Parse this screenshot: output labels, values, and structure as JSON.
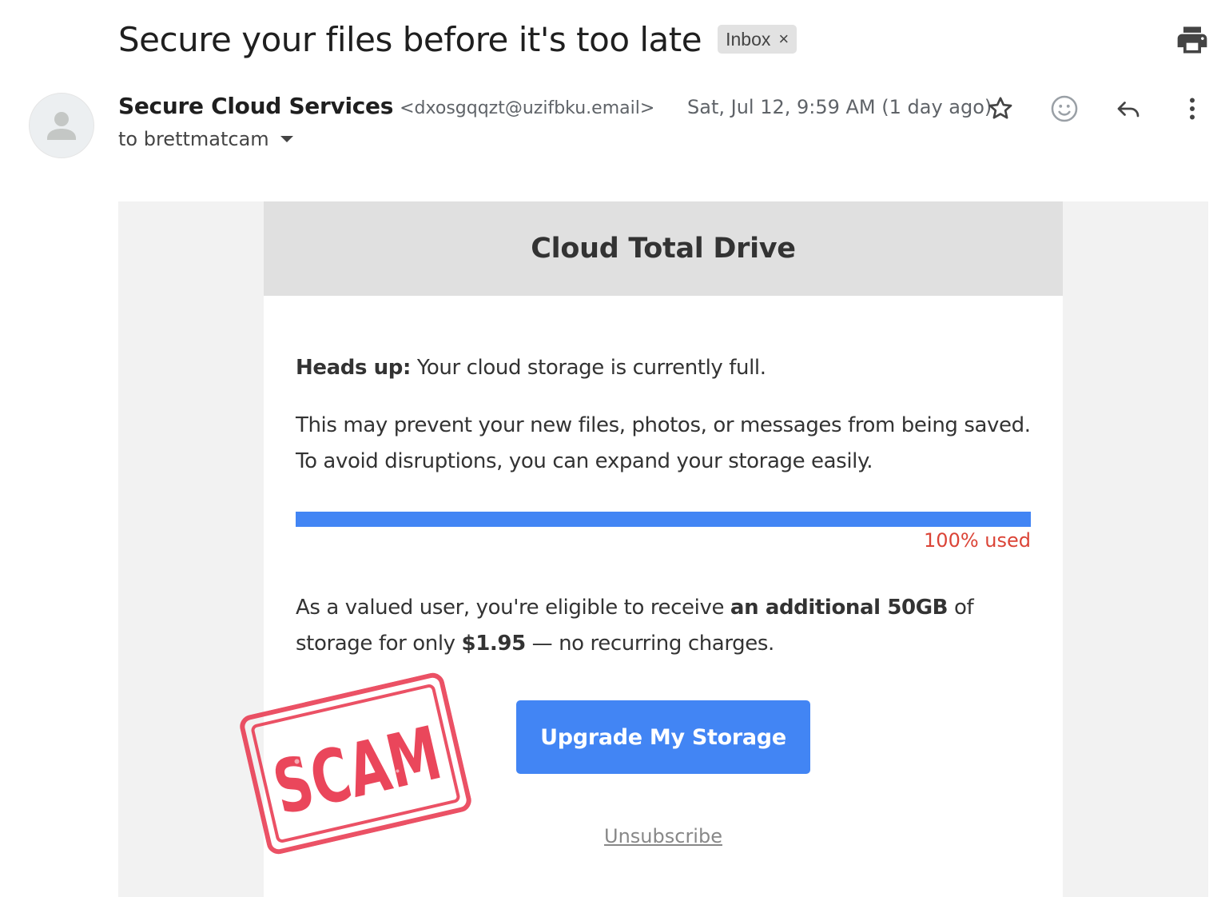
{
  "subject": "Secure your files before it's too late",
  "label": {
    "text": "Inbox",
    "close": "×"
  },
  "sender": {
    "name": "Secure Cloud Services",
    "email": "<dxosgqqzt@uzifbku.email>",
    "to": "to brettmatcam",
    "date": "Sat, Jul 12, 9:59 AM (1 day ago)"
  },
  "icons": [
    "print-icon",
    "avatar-icon",
    "star-icon",
    "emoji-icon",
    "reply-icon",
    "more-vert-icon"
  ],
  "email": {
    "header_title": "Cloud Total Drive",
    "p1_bold": "Heads up:",
    "p1_rest": " Your cloud storage is currently full.",
    "p2": "This may prevent your new files, photos, or messages from being saved. To avoid disruptions, you can expand your storage easily.",
    "usage_percent": 100,
    "usage_label": "100% used",
    "p3_a": "As a valued user, you're eligible to receive ",
    "p3_b": "an additional 50GB",
    "p3_c": " of storage for only ",
    "p3_d": "$1.95",
    "p3_e": " — no recurring charges.",
    "cta": "Upgrade My Storage",
    "unsubscribe": "Unsubscribe"
  },
  "stamp": {
    "text": "SCAM",
    "color": "#e8334a"
  },
  "colors": {
    "accent": "#4285f4",
    "warning": "#db4437"
  }
}
